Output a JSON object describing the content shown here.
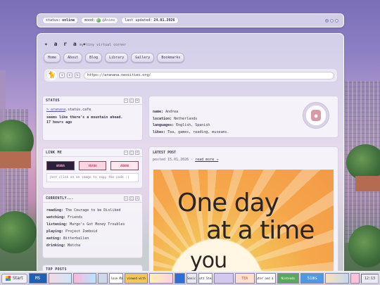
{
  "topbar": {
    "status_label": "status:",
    "status_value": "online",
    "mood_label": "mood:",
    "mood_value": "@Anime",
    "updated_label": "last updated:",
    "updated_value": "24.01.2026"
  },
  "site": {
    "logo": "✦ a r a ✦",
    "tagline": "my tiny virtual corner",
    "nav": [
      "Home",
      "About",
      "Blog",
      "Library",
      "Gallery",
      "Bookmarks"
    ],
    "back": "◂",
    "forward": "▸",
    "refresh": "↻",
    "url": "https://aranana.neocities.org/"
  },
  "status_panel": {
    "title": "STATUS",
    "handle": "> aranana",
    "site": ".status.cafe",
    "dots": "...",
    "message": "seems like there's a mountain ahead.",
    "time": "17 hours ago"
  },
  "linkme_panel": {
    "title": "LINK ME",
    "buttons": [
      "ARANA",
      "ARANA",
      "ARANA"
    ],
    "hint": "just click on an image to copy the code :)"
  },
  "currently_panel": {
    "title": "CURRENTLY...",
    "rows": [
      {
        "label": "reading:",
        "value": "The Courage to be Disliked"
      },
      {
        "label": "watching:",
        "value": "Friends"
      },
      {
        "label": "listening:",
        "value": "Margo's Got Money Troubles"
      },
      {
        "label": "playing:",
        "value": "Project Zomboid"
      },
      {
        "label": "eating:",
        "value": "Bitterballen"
      },
      {
        "label": "drinking:",
        "value": "Matcha"
      }
    ]
  },
  "top_posts_panel": {
    "title": "TOP POSTS"
  },
  "profile": {
    "rows": [
      {
        "label": "name:",
        "value": "Andrea"
      },
      {
        "label": "location:",
        "value": "Netherlands"
      },
      {
        "label": "languages:",
        "value": "English, Spanish"
      },
      {
        "label": "likes:",
        "value": "Tea, games, reading, museums."
      }
    ]
  },
  "latest_post": {
    "title": "LATEST POST",
    "posted": "posted 15.01.2026 -",
    "read_more": "read more →",
    "image_text": [
      "One day",
      "at a time",
      "you"
    ]
  },
  "panel_controls": [
    "–",
    "□",
    "×"
  ],
  "taskbar": {
    "start": "Start",
    "buttons": [
      "MS",
      "",
      "",
      "",
      "I love Mac",
      "Best viewed with Eyes",
      "",
      "",
      "Sonic",
      "Scott Steam",
      "",
      "TEA",
      "a computer and a monkey",
      "Nintendo",
      "Sims",
      "",
      ""
    ],
    "clock": "12:13"
  },
  "colors": {
    "accent": "#4d55b5",
    "panel_bg": "#f6f4fa",
    "post_image": "#f3a84c"
  }
}
